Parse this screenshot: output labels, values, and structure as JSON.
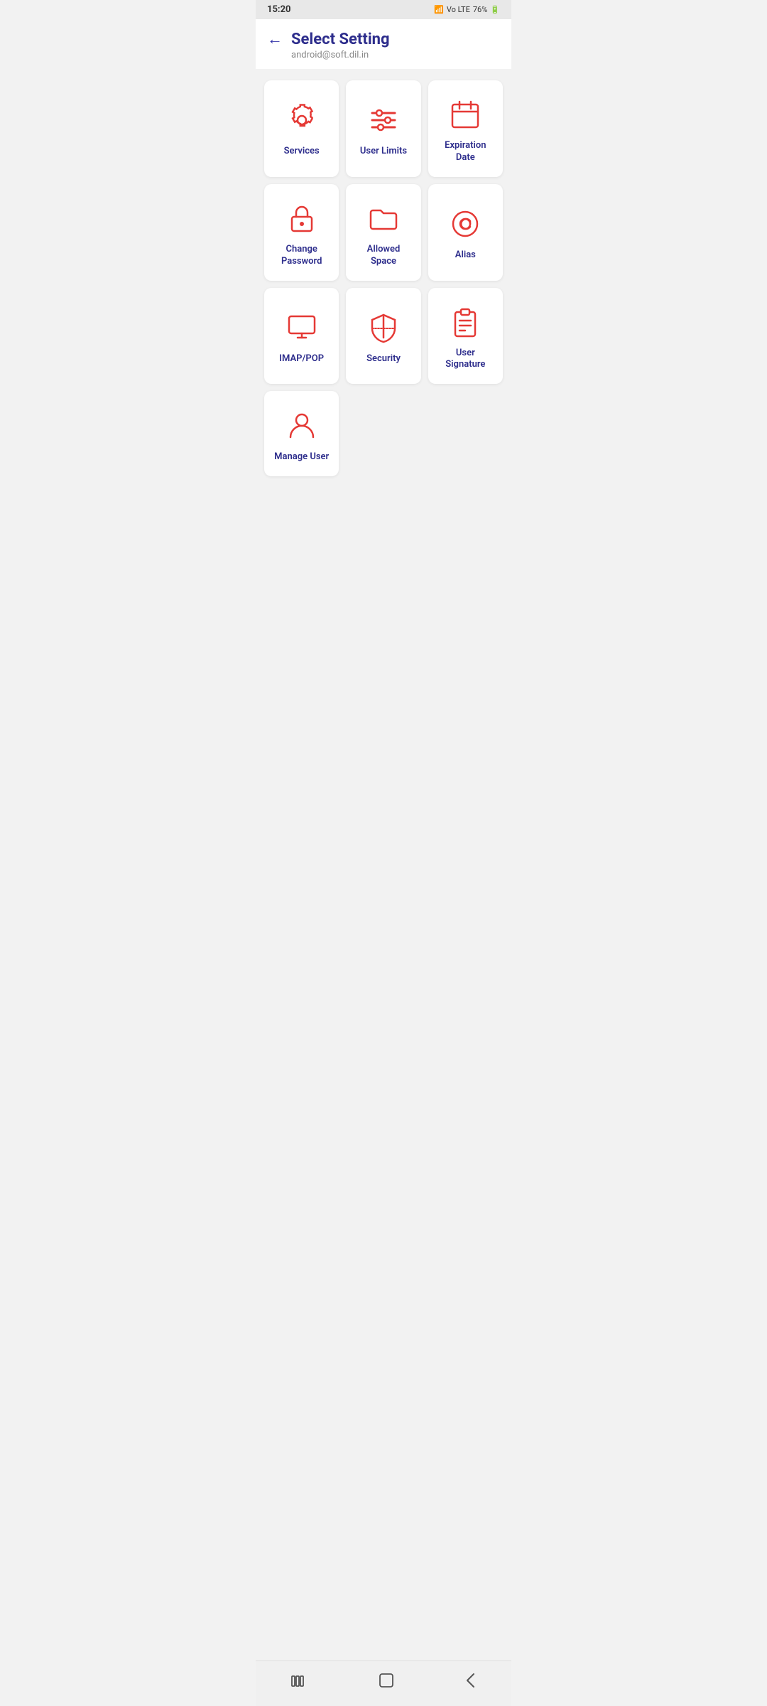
{
  "status_bar": {
    "time": "15:20",
    "battery": "76%",
    "signal": "Vo LTE"
  },
  "header": {
    "title": "Select Setting",
    "subtitle": "android@soft.dil.in",
    "back_label": "←"
  },
  "grid": {
    "items": [
      {
        "id": "services",
        "label": "Services",
        "icon": "gear"
      },
      {
        "id": "user-limits",
        "label": "User Limits",
        "icon": "sliders"
      },
      {
        "id": "expiration-date",
        "label": "Expiration Date",
        "icon": "calendar"
      },
      {
        "id": "change-password",
        "label": "Change Password",
        "icon": "lock"
      },
      {
        "id": "allowed-space",
        "label": "Allowed Space",
        "icon": "folder"
      },
      {
        "id": "alias",
        "label": "Alias",
        "icon": "at"
      },
      {
        "id": "imap-pop",
        "label": "IMAP/POP",
        "icon": "monitor"
      },
      {
        "id": "security",
        "label": "Security",
        "icon": "shield"
      },
      {
        "id": "user-signature",
        "label": "User Signature",
        "icon": "clipboard"
      },
      {
        "id": "manage-user",
        "label": "Manage User",
        "icon": "person"
      }
    ]
  },
  "nav": {
    "menu": "|||",
    "home": "○",
    "back": "<"
  },
  "colors": {
    "icon_red": "#e53935",
    "label_blue": "#2d2d8c",
    "back_arrow": "#3333aa"
  }
}
